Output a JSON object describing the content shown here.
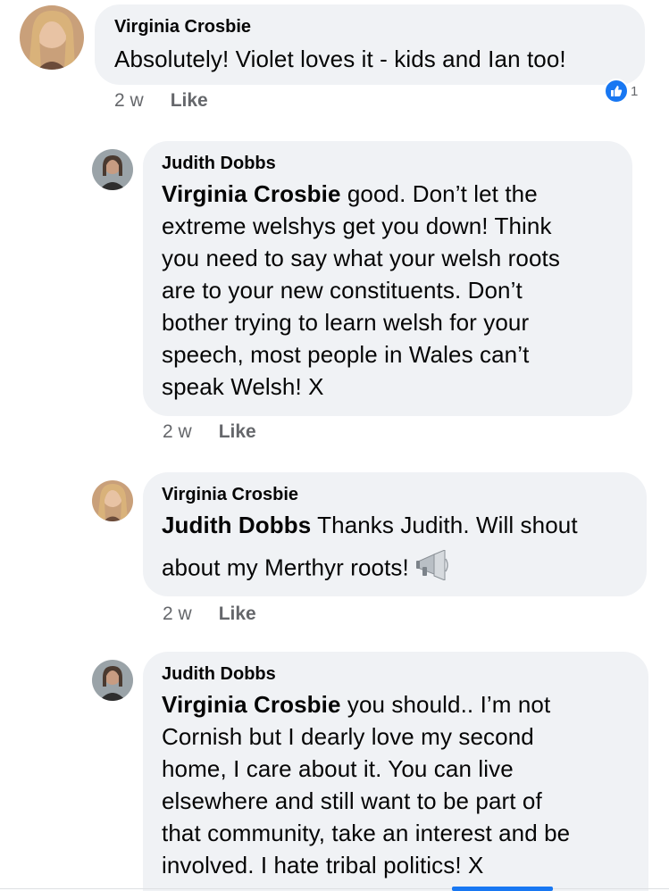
{
  "comments": [
    {
      "author": "Virginia Crosbie",
      "text": "Absolutely! Violet loves it - kids and Ian too!",
      "time": "2 w",
      "like_label": "Like",
      "reaction_count": "1"
    },
    {
      "author": "Judith Dobbs",
      "mention": "Virginia Crosbie",
      "lines": [
        " good. Don’t let the",
        "extreme welshys get you down! Think",
        "you need to say what your welsh roots",
        "are to your new constituents. Don’t",
        "bother trying to learn welsh for your",
        "speech, most people in Wales can’t",
        "speak Welsh! X"
      ],
      "time": "2 w",
      "like_label": "Like"
    },
    {
      "author": "Virginia Crosbie",
      "mention": "Judith Dobbs",
      "lines": [
        " Thanks Judith. Will shout",
        "about my Merthyr roots!"
      ],
      "emoji": "megaphone-emoji",
      "time": "2 w",
      "like_label": "Like"
    },
    {
      "author": "Judith Dobbs",
      "mention": "Virginia Crosbie",
      "lines": [
        " you should.. I’m not",
        "Cornish but I dearly love my second",
        "home, I care about it. You can live",
        "elsewhere and still want to be part of",
        "that community, take an interest and be",
        "involved. I hate tribal politics! X"
      ]
    }
  ],
  "colors": {
    "bubble": "#f0f2f5",
    "meta_text": "#65676b",
    "like_blue": "#1877f2"
  }
}
